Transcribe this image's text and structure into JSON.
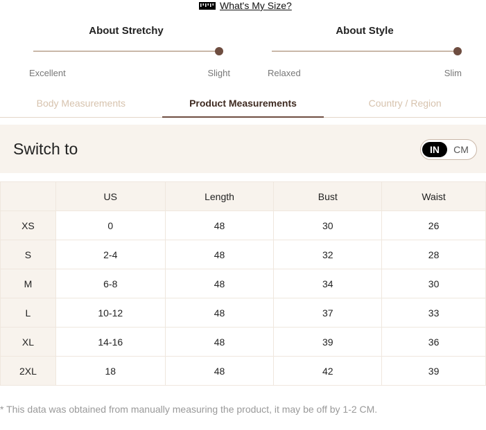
{
  "size_guide": {
    "link_label": "What's My Size?"
  },
  "stretchy": {
    "title": "About Stretchy",
    "left_label": "Excellent",
    "right_label": "Slight",
    "level": 1.0
  },
  "style": {
    "title": "About Style",
    "left_label": "Relaxed",
    "right_label": "Slim",
    "level": 1.0
  },
  "tabs": [
    {
      "label": "Body Measurements",
      "active": false
    },
    {
      "label": "Product Measurements",
      "active": true
    },
    {
      "label": "Country / Region",
      "active": false
    }
  ],
  "unit_switch": {
    "label": "Switch to",
    "option_in": "IN",
    "option_cm": "CM",
    "selected": "IN"
  },
  "table": {
    "headers": [
      "",
      "US",
      "Length",
      "Bust",
      "Waist"
    ],
    "rows": [
      [
        "XS",
        "0",
        "48",
        "30",
        "26"
      ],
      [
        "S",
        "2-4",
        "48",
        "32",
        "28"
      ],
      [
        "M",
        "6-8",
        "48",
        "34",
        "30"
      ],
      [
        "L",
        "10-12",
        "48",
        "37",
        "33"
      ],
      [
        "XL",
        "14-16",
        "48",
        "39",
        "36"
      ],
      [
        "2XL",
        "18",
        "48",
        "42",
        "39"
      ]
    ]
  },
  "footnote": "* This data was obtained from manually measuring the product, it may be off by 1-2 CM.",
  "colors": {
    "accent": "#6e4d40",
    "panel": "#f8f3ed",
    "inactive_tab": "#d7c3ae"
  }
}
